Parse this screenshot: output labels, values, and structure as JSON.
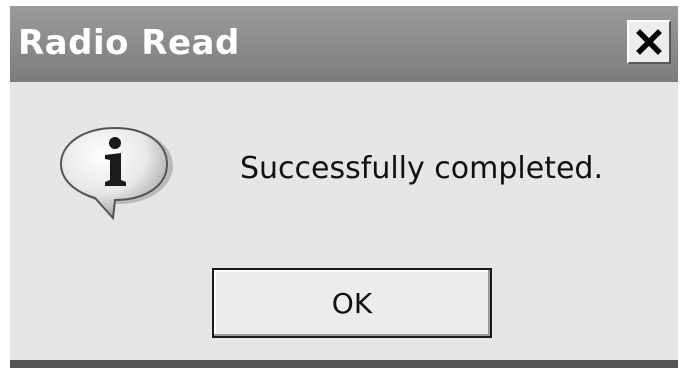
{
  "window": {
    "title": "Radio Read",
    "close_icon": "close-icon"
  },
  "body": {
    "icon": "information-icon",
    "message": "Successfully completed."
  },
  "buttons": {
    "ok_label": "OK"
  },
  "colors": {
    "titlebar": "#8a8a8a",
    "title_text": "#ffffff",
    "dialog_background": "#e6e6e6"
  }
}
